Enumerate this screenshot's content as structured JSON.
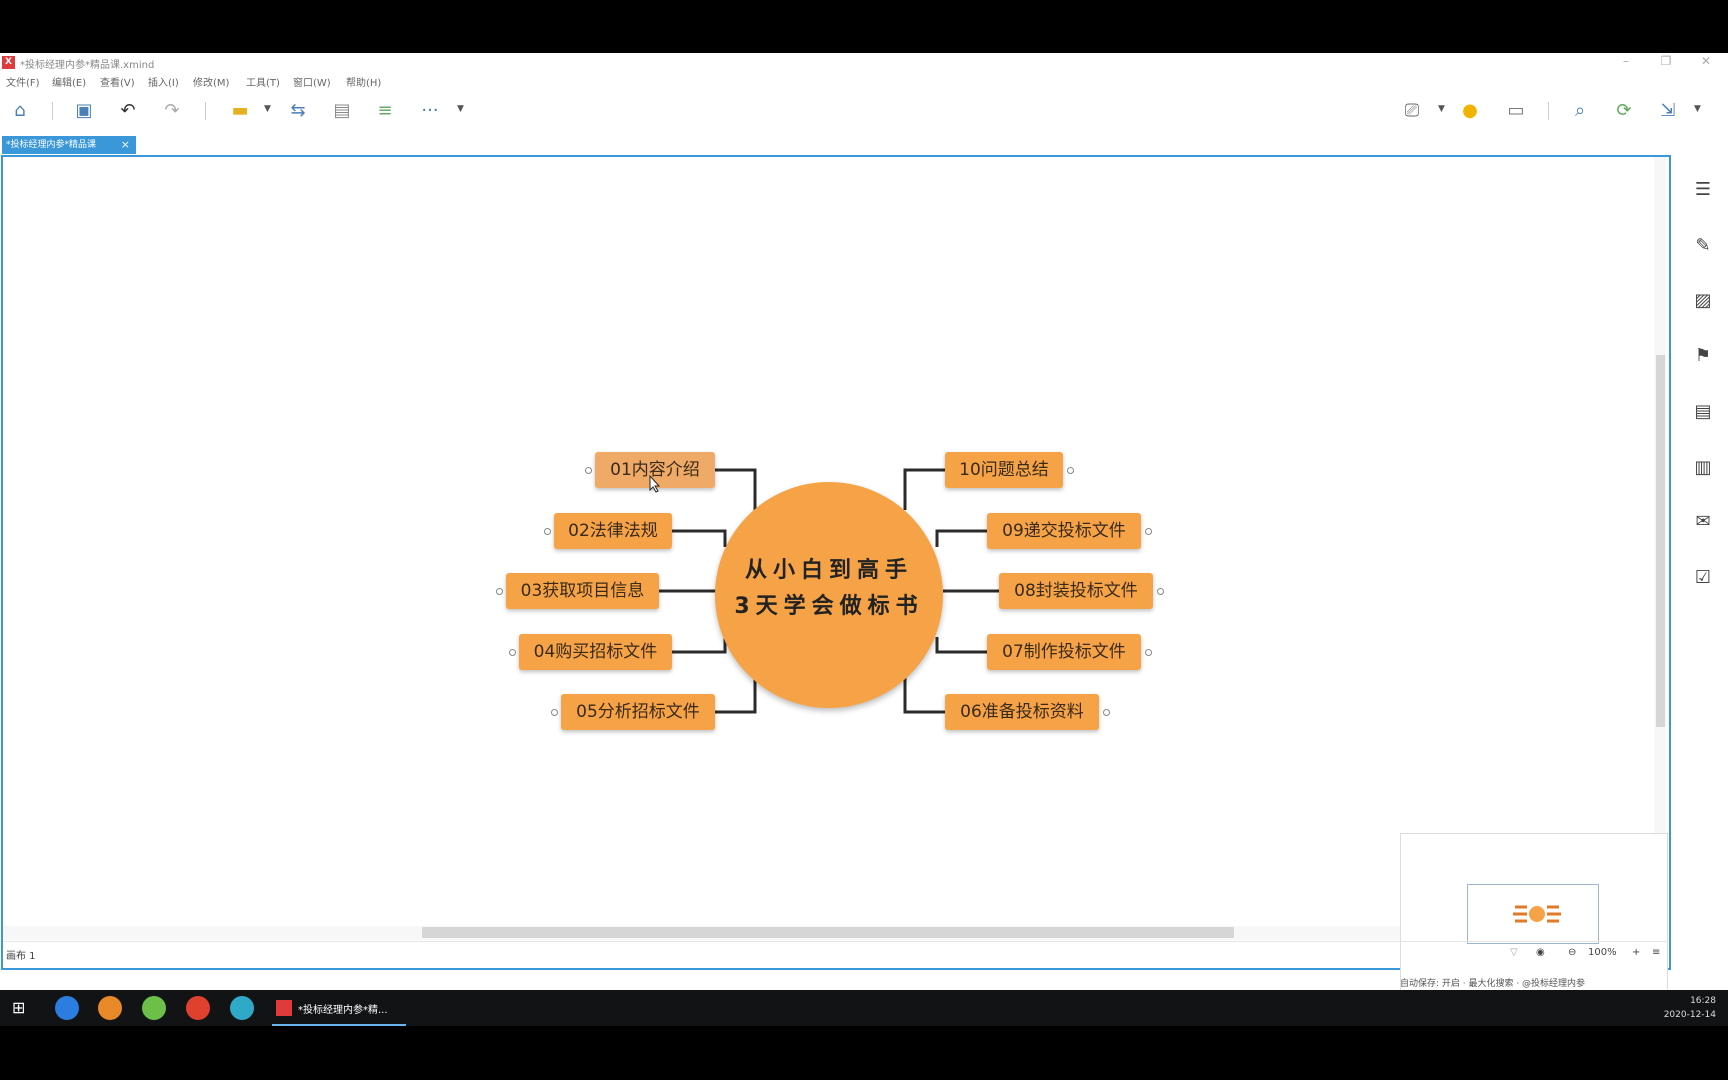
{
  "app": {
    "title": "*投标经理内参*精品课.xmind",
    "logo": "X"
  },
  "menu": [
    "文件(F)",
    "编辑(E)",
    "查看(V)",
    "插入(I)",
    "修改(M)",
    "工具(T)",
    "窗口(W)",
    "帮助(H)"
  ],
  "tab": {
    "label": "*投标经理内参*精品课",
    "close": "×"
  },
  "mindmap": {
    "central": [
      "从小白到高手",
      "3天学会做标书"
    ],
    "left_topics": [
      "01内容介绍",
      "02法律法规",
      "03获取项目信息",
      "04购买招标文件",
      "05分析招标文件"
    ],
    "right_topics": [
      "10问题总结",
      "09递交投标文件",
      "08封装投标文件",
      "07制作投标文件",
      "06准备投标资料"
    ],
    "topic_color": "#f5a346",
    "accent_color": "#3a97d8"
  },
  "statusbar": {
    "sheet": "画布 1",
    "zoom": "100%",
    "info": "自动保存: 开启  ·  最大化搜索  ·  @投标经理内参"
  },
  "taskbar": {
    "active_app": "*投标经理内参*精...",
    "time": "16:28",
    "date": "2020-12-14"
  }
}
